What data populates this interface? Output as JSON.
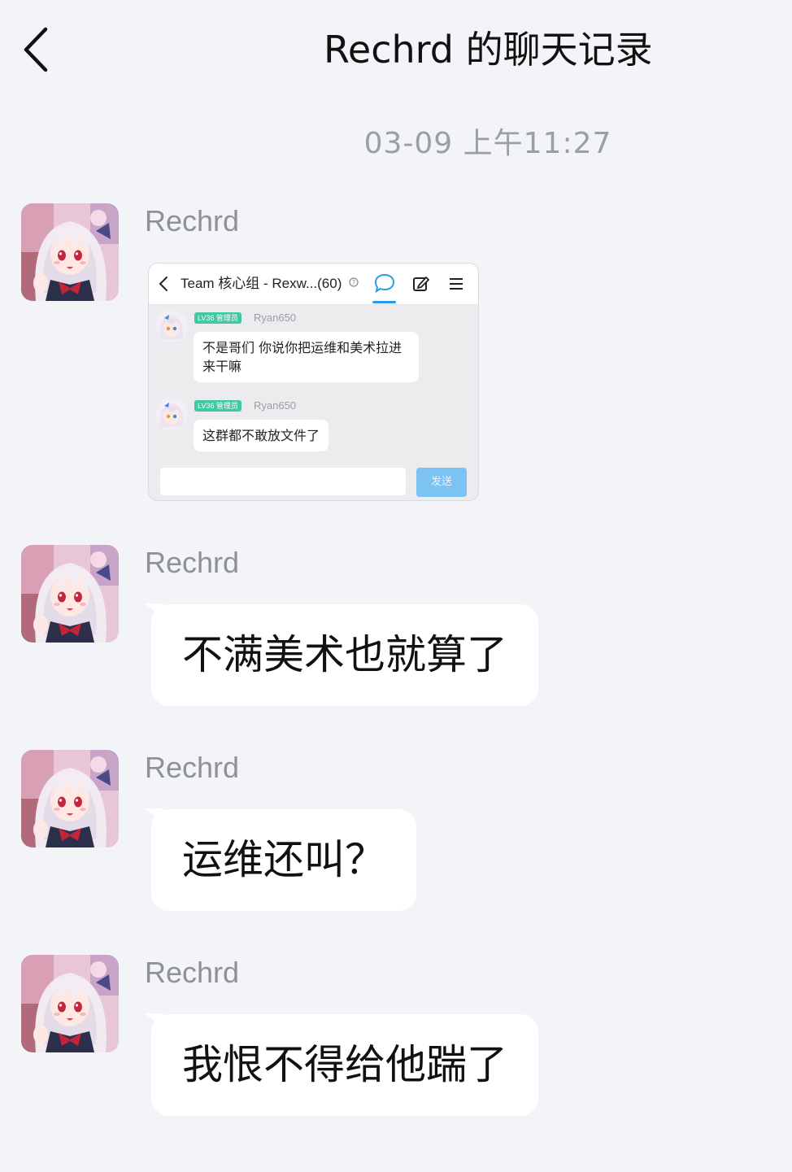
{
  "header": {
    "title": "Rechrd 的聊天记录"
  },
  "timestamp": "03-09 上午11:27",
  "messages": [
    {
      "sender": "Rechrd",
      "type": "image",
      "screenshot": {
        "title": "Team 核心组 - Rexw...(60)",
        "messages": [
          {
            "level": "LV36",
            "role": "管理员",
            "name": "Ryan650",
            "text": "不是哥们 你说你把运维和美术拉进来干嘛"
          },
          {
            "level": "LV36",
            "role": "管理员",
            "name": "Ryan650",
            "text": "这群都不敢放文件了"
          }
        ],
        "send_label": "发送"
      }
    },
    {
      "sender": "Rechrd",
      "type": "text",
      "text": "不满美术也就算了"
    },
    {
      "sender": "Rechrd",
      "type": "text",
      "text": "运维还叫？"
    },
    {
      "sender": "Rechrd",
      "type": "text",
      "text": "我恨不得给他踹了"
    }
  ],
  "colors": {
    "background": "#f3f4f8",
    "bubble": "#ffffff",
    "sender_text": "#8e9199",
    "timestamp_text": "#9a9ea6",
    "accent_blue": "#2a9be0",
    "admin_badge": "#40c9a2"
  },
  "icons": {
    "back": "chevron-left-icon",
    "chat": "chat-bubble-icon",
    "edit": "edit-icon",
    "menu": "menu-icon",
    "help": "help-icon"
  }
}
